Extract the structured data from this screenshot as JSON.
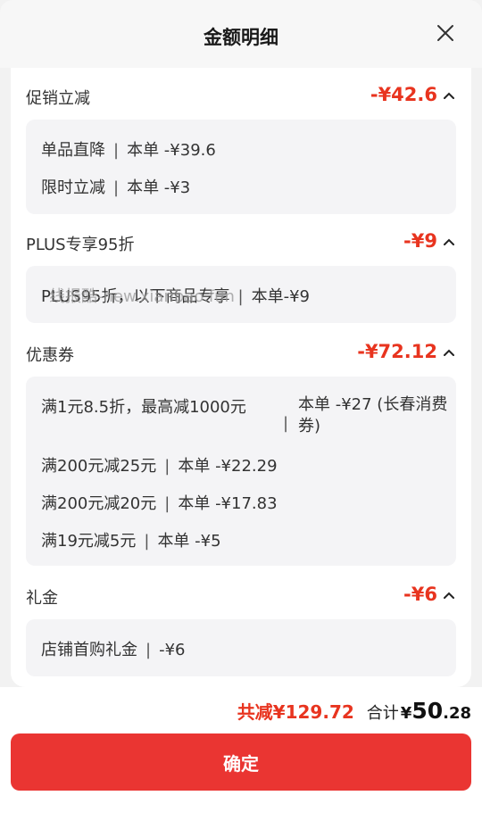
{
  "header": {
    "title": "金额明细"
  },
  "sections": [
    {
      "label": "促销立减",
      "amount": "-¥42.6",
      "items": [
        {
          "name": "单品直降",
          "detail": "本单 -¥39.6"
        },
        {
          "name": "限时立减",
          "detail": "本单 -¥3"
        }
      ]
    },
    {
      "label": "PLUS专享95折",
      "amount": "-¥9",
      "items": [
        {
          "name": "PLUS95折，以下商品专享",
          "detail": "本单-¥9"
        }
      ]
    },
    {
      "label": "优惠券",
      "amount": "-¥72.12",
      "items": [
        {
          "name": "满1元8.5折，最高减1000元",
          "detail": "本单 -¥27 (长春消费券)"
        },
        {
          "name": "满200元减25元",
          "detail": "本单 -¥22.29"
        },
        {
          "name": "满200元减20元",
          "detail": "本单 -¥17.83"
        },
        {
          "name": "满19元减5元",
          "detail": "本单 -¥5"
        }
      ]
    },
    {
      "label": "礼金",
      "amount": "-¥6",
      "items": [
        {
          "name": "店铺首购礼金",
          "detail": "-¥6"
        }
      ]
    }
  ],
  "separator": "|",
  "watermark": "线报酷-new.xianbao.fun",
  "footer": {
    "savings": "共减¥129.72",
    "total_label": "合计",
    "total_currency": "¥",
    "total_int": "50",
    "total_dec": ".28",
    "confirm_label": "确定"
  },
  "icons": {
    "close": "close-icon",
    "chevron": "chevron-up-icon"
  },
  "colors": {
    "accent": "#e8341f",
    "button": "#ea3532"
  }
}
